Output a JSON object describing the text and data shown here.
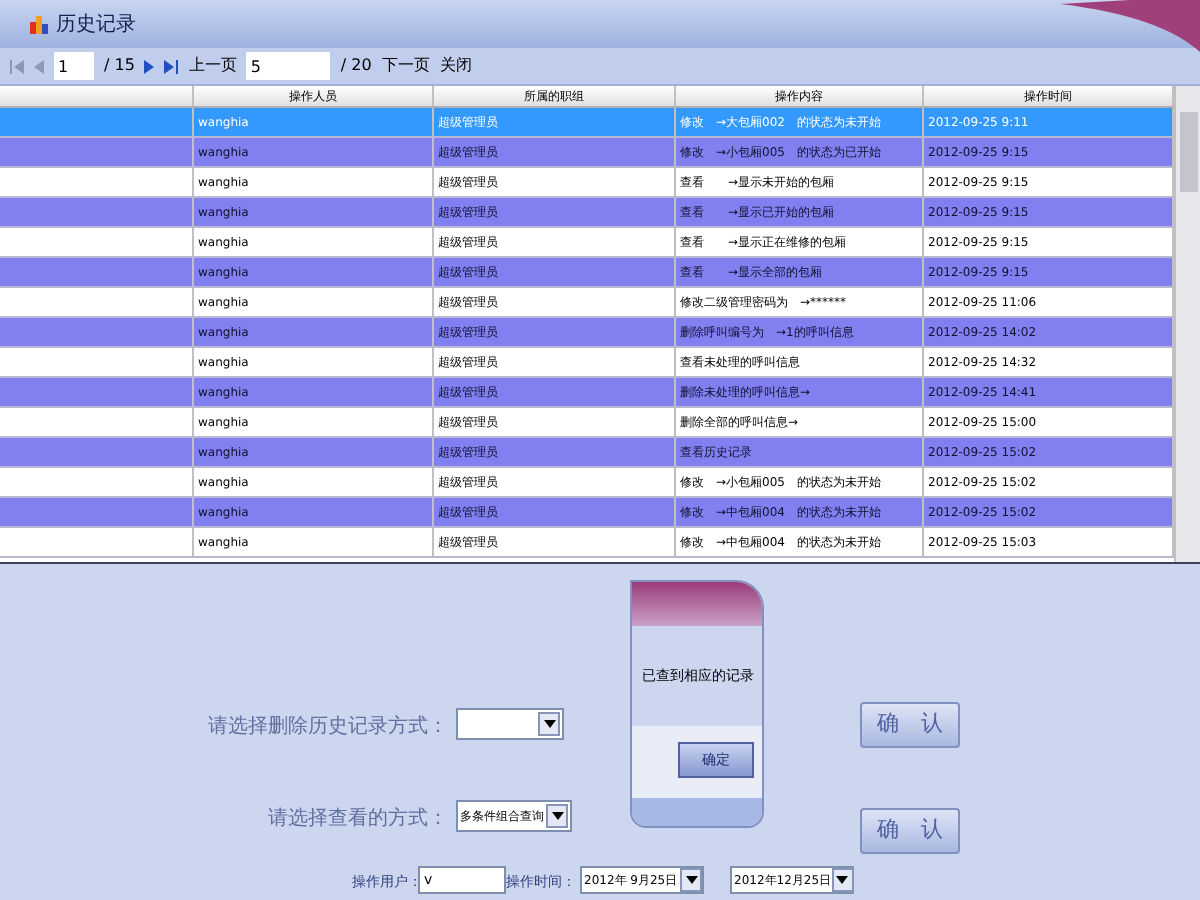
{
  "window": {
    "title": "历史记录"
  },
  "pager": {
    "first_page": "1",
    "first_total": "/ 15",
    "prev_label": "上一页",
    "second_page": "5",
    "second_total": "/ 20",
    "next_label": "下一页",
    "close_label": "关闭"
  },
  "table": {
    "columns": [
      "操作人员",
      "所属的职组",
      "操作内容",
      "操作时间"
    ],
    "rows": [
      {
        "selected": true,
        "cells": [
          "wanghia",
          "超级管理员",
          "修改　→大包厢002　的状态为未开始",
          "2012-09-25 9:11"
        ]
      },
      {
        "selected": false,
        "cells": [
          "wanghia",
          "超级管理员",
          "修改　→小包厢005　的状态为已开始",
          "2012-09-25 9:15"
        ]
      },
      {
        "selected": false,
        "cells": [
          "wanghia",
          "超级管理员",
          "查看　　→显示未开始的包厢",
          "2012-09-25 9:15"
        ]
      },
      {
        "selected": false,
        "cells": [
          "wanghia",
          "超级管理员",
          "查看　　→显示已开始的包厢",
          "2012-09-25 9:15"
        ]
      },
      {
        "selected": false,
        "cells": [
          "wanghia",
          "超级管理员",
          "查看　　→显示正在维修的包厢",
          "2012-09-25 9:15"
        ]
      },
      {
        "selected": false,
        "cells": [
          "wanghia",
          "超级管理员",
          "查看　　→显示全部的包厢",
          "2012-09-25 9:15"
        ]
      },
      {
        "selected": false,
        "cells": [
          "wanghia",
          "超级管理员",
          "修改二级管理密码为　→******",
          "2012-09-25 11:06"
        ]
      },
      {
        "selected": false,
        "cells": [
          "wanghia",
          "超级管理员",
          "删除呼叫编号为　→1的呼叫信息",
          "2012-09-25 14:02"
        ]
      },
      {
        "selected": false,
        "cells": [
          "wanghia",
          "超级管理员",
          "查看未处理的呼叫信息",
          "2012-09-25 14:32"
        ]
      },
      {
        "selected": false,
        "cells": [
          "wanghia",
          "超级管理员",
          "删除未处理的呼叫信息→",
          "2012-09-25 14:41"
        ]
      },
      {
        "selected": false,
        "cells": [
          "wanghia",
          "超级管理员",
          "删除全部的呼叫信息→",
          "2012-09-25 15:00"
        ]
      },
      {
        "selected": false,
        "cells": [
          "wanghia",
          "超级管理员",
          "查看历史记录",
          "2012-09-25 15:02"
        ]
      },
      {
        "selected": false,
        "cells": [
          "wanghia",
          "超级管理员",
          "修改　→小包厢005　的状态为未开始",
          "2012-09-25 15:02"
        ]
      },
      {
        "selected": false,
        "cells": [
          "wanghia",
          "超级管理员",
          "修改　→中包厢004　的状态为未开始",
          "2012-09-25 15:02"
        ]
      },
      {
        "selected": false,
        "cells": [
          "wanghia",
          "超级管理员",
          "修改　→中包厢004　的状态为未开始",
          "2012-09-25 15:03"
        ]
      }
    ]
  },
  "delete_mode": {
    "label": "请选择删除历史记录方式：",
    "button": "确　认"
  },
  "view_mode": {
    "label": "请选择查看的方式：",
    "value": "多条件组合查询",
    "button": "确　认"
  },
  "filter": {
    "user_label": "操作用户：",
    "user_value": "v",
    "time_label": "操作时间：",
    "date_from": "2012年 9月25日",
    "date_to": "2012年12月25日"
  },
  "dialog": {
    "message": "已查到相应的记录",
    "button": "确定"
  }
}
